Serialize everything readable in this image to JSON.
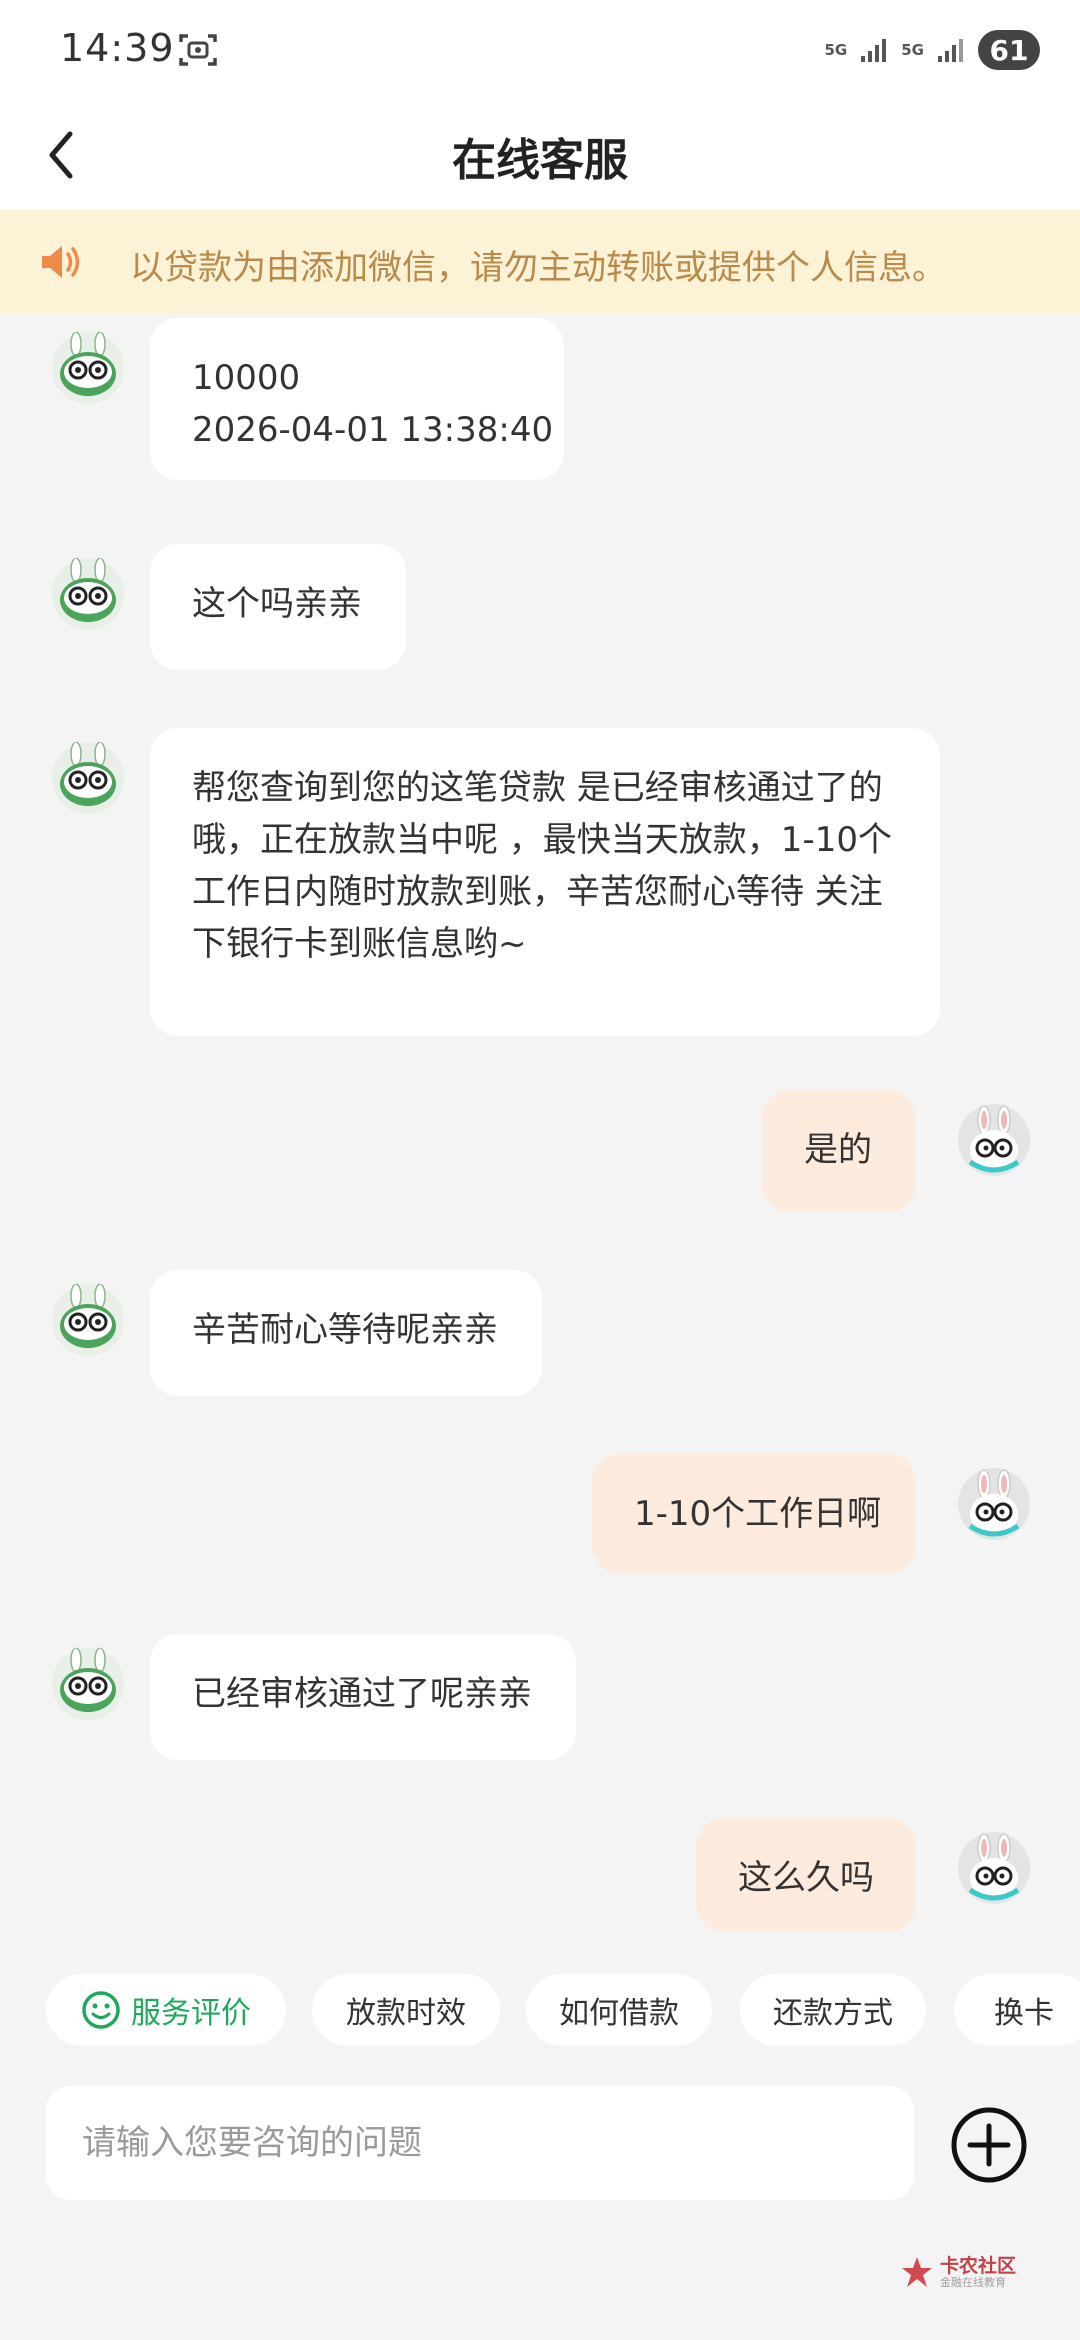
{
  "status_bar": {
    "time": "14:39",
    "network_1": "5G",
    "network_2": "5G",
    "battery": "61"
  },
  "header": {
    "title": "在线客服",
    "back_icon": "chevron-left-icon"
  },
  "notice": {
    "icon": "speaker-icon",
    "text": "以贷款为由添加微信，请勿主动转账或提供个人信息。"
  },
  "messages": [
    {
      "side": "agent",
      "lines": [
        "10000",
        "2026-04-01 13:38:40"
      ]
    },
    {
      "side": "agent",
      "lines": [
        "这个吗亲亲"
      ]
    },
    {
      "side": "agent",
      "lines": [
        "帮您查询到您的这笔贷款 是已经审核通过了的",
        "哦，正在放款当中呢 ，最快当天放款，1-10个",
        "工作日内随时放款到账，辛苦您耐心等待 关注",
        "下银行卡到账信息哟~"
      ]
    },
    {
      "side": "user",
      "lines": [
        "是的"
      ]
    },
    {
      "side": "agent",
      "lines": [
        "辛苦耐心等待呢亲亲"
      ]
    },
    {
      "side": "user",
      "lines": [
        "1-10个工作日啊"
      ]
    },
    {
      "side": "agent",
      "lines": [
        "已经审核通过了呢亲亲"
      ]
    },
    {
      "side": "user",
      "lines": [
        "这么久吗"
      ]
    }
  ],
  "quick_actions": [
    {
      "label": "服务评价",
      "icon": "smile-icon"
    },
    {
      "label": "放款时效"
    },
    {
      "label": "如何借款"
    },
    {
      "label": "还款方式"
    },
    {
      "label": "换卡"
    }
  ],
  "input": {
    "placeholder": "请输入您要咨询的问题",
    "value": "",
    "plus_icon": "plus-circle-icon"
  },
  "watermark": {
    "title": "卡农社区",
    "subtitle": "金融在线教育"
  },
  "colors": {
    "background": "#f4f4f4",
    "agent_bubble": "#ffffff",
    "user_bubble": "#fdebdd",
    "notice_bg": "#fcf2d6",
    "notice_text": "#b98a4a",
    "accent_green": "#1fa85a"
  }
}
